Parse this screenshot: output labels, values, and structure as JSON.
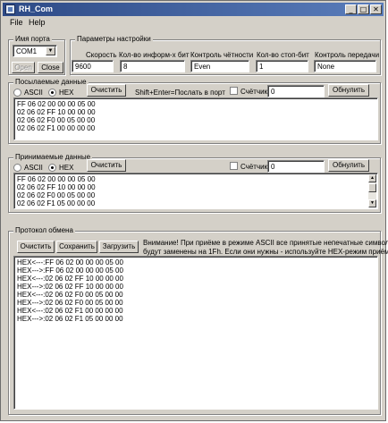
{
  "window": {
    "title": "RH_Com"
  },
  "titlebar_buttons": {
    "minimize": "_",
    "maximize": "□",
    "close": "✕"
  },
  "menu": [
    "File",
    "Help"
  ],
  "port": {
    "group": "Имя порта",
    "selected": "COM1",
    "open_label": "Open",
    "close_label": "Close"
  },
  "settings": {
    "group": "Параметры настройки",
    "speed_label": "Скорость",
    "speed_value": "9600",
    "databits_label": "Кол-во информ-х бит",
    "databits_value": "8",
    "parity_label": "Контроль чётности",
    "parity_value": "Even",
    "stopbits_label": "Кол-во стоп-бит",
    "stopbits_value": "1",
    "flow_label": "Контроль передачи",
    "flow_value": "None"
  },
  "send": {
    "group": "Посылаемые данные",
    "ascii_label": "ASCII",
    "hex_label": "HEX",
    "clear_label": "Очистить",
    "hint": "Shift+Enter=Послать в порт",
    "counter_label": "Счётчик",
    "counter_value": "0",
    "reset_label": "Обнулить",
    "lines": [
      "FF 06 02 00 00 00 05 00",
      "02 06 02 FF 10 00 00 00",
      "02 06 02 F0 00 05 00 00",
      "02 06 02 F1 00 00 00 00"
    ]
  },
  "receive": {
    "group": "Принимаемые данные",
    "ascii_label": "ASCII",
    "hex_label": "HEX",
    "clear_label": "Очистить",
    "counter_label": "Счётчик",
    "counter_value": "0",
    "reset_label": "Обнулить",
    "lines": [
      "FF 06 02 00 00 00 05 00",
      "02 06 02 FF 10 00 00 00",
      "02 06 02 F0 00 05 00 00",
      "02 06 02 F1 05 00 00 00"
    ]
  },
  "log": {
    "group": "Протокол обмена",
    "clear_label": "Очистить",
    "save_label": "Сохранить",
    "load_label": "Загрузить",
    "warning_line1": "Внимание! При приёме в режиме ASCII все принятые непечатные символы",
    "warning_line2": "будут заменены на 1Fh. Если они нужны - используйте HEX-режим приёма",
    "lines": [
      "HEX<---:FF 06 02 00 00 00 05 00",
      "HEX--->:FF 06 02 00 00 00 05 00",
      "HEX<---:02 06 02 FF 10 00 00 00",
      "HEX--->:02 06 02 FF 10 00 00 00",
      "HEX<---:02 06 02 F0 00 05 00 00",
      "HEX--->:02 06 02 F0 00 05 00 00",
      "HEX<---:02 06 02 F1 00 00 00 00",
      "HEX--->:02 06 02 F1 05 00 00 00"
    ]
  },
  "scroll": {
    "up": "▲",
    "down": "▼"
  },
  "combo_arrow": "▼"
}
